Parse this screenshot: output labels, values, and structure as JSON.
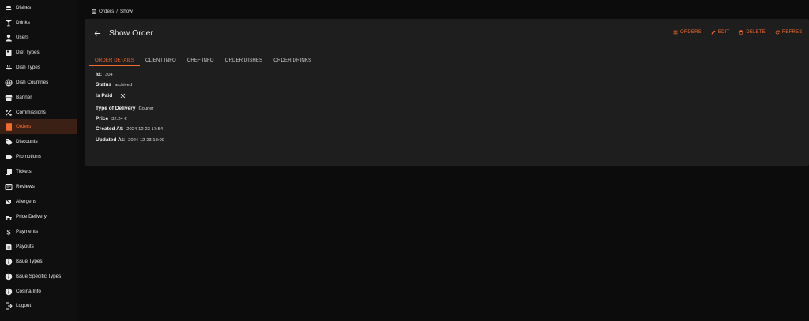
{
  "sidebar": {
    "items": [
      {
        "label": "Dishes",
        "icon": "dishes-icon",
        "active": false
      },
      {
        "label": "Drinks",
        "icon": "cocktail-icon",
        "active": false
      },
      {
        "label": "Users",
        "icon": "person-icon",
        "active": false
      },
      {
        "label": "Diet Types",
        "icon": "book-icon",
        "active": false
      },
      {
        "label": "Dish Types",
        "icon": "ramen-icon",
        "active": false
      },
      {
        "label": "Dish Countries",
        "icon": "globe-icon",
        "active": false
      },
      {
        "label": "Banner",
        "icon": "storefront-icon",
        "active": false
      },
      {
        "label": "Commissions",
        "icon": "percent-icon",
        "active": false
      },
      {
        "label": "Orders",
        "icon": "receipt-icon",
        "active": true
      },
      {
        "label": "Discounts",
        "icon": "tag-icon",
        "active": false
      },
      {
        "label": "Promotions",
        "icon": "label-icon",
        "active": false
      },
      {
        "label": "Tickets",
        "icon": "tickets-icon",
        "active": false
      },
      {
        "label": "Reviews",
        "icon": "reviews-icon",
        "active": false
      },
      {
        "label": "Allergens",
        "icon": "allergen-icon",
        "active": false
      },
      {
        "label": "Price Delivery",
        "icon": "delivery-icon",
        "active": false
      },
      {
        "label": "Payments",
        "icon": "dollar-icon",
        "active": false
      },
      {
        "label": "Payouts",
        "icon": "document-icon",
        "active": false
      },
      {
        "label": "Issue Types",
        "icon": "info-icon",
        "active": false
      },
      {
        "label": "Issue Specific Types",
        "icon": "info-icon",
        "active": false
      },
      {
        "label": "Cosina Info",
        "icon": "info-icon",
        "active": false
      },
      {
        "label": "Logout",
        "icon": "logout-icon",
        "active": false
      }
    ]
  },
  "breadcrumb": {
    "root": "Orders",
    "separator": "/",
    "current": "Show"
  },
  "header": {
    "title": "Show Order"
  },
  "actions": {
    "orders": "ORDERS",
    "edit": "EDIT",
    "delete": "DELETE",
    "refresh": "REFRES"
  },
  "tabs": [
    "ORDER DETAILS",
    "CLIENT INFO",
    "CHEF INFO",
    "ORDER DISHES",
    "ORDER DRINKS"
  ],
  "details": {
    "id_label": "Id:",
    "id_value": "304",
    "status_label": "Status",
    "status_value": "archived",
    "paid_label": "Is Paid",
    "delivery_label": "Type of Delivery",
    "delivery_value": "Courier",
    "price_label": "Price",
    "price_value": "32.24 €",
    "created_label": "Created At:",
    "created_value": "2024-12-23 17:54",
    "updated_label": "Updated At:",
    "updated_value": "2024-12-23 18:00"
  },
  "colors": {
    "accent": "#f26b2e",
    "background": "#0c0c0c",
    "card": "#1e1e1e",
    "active_item_bg": "#3a2015"
  }
}
